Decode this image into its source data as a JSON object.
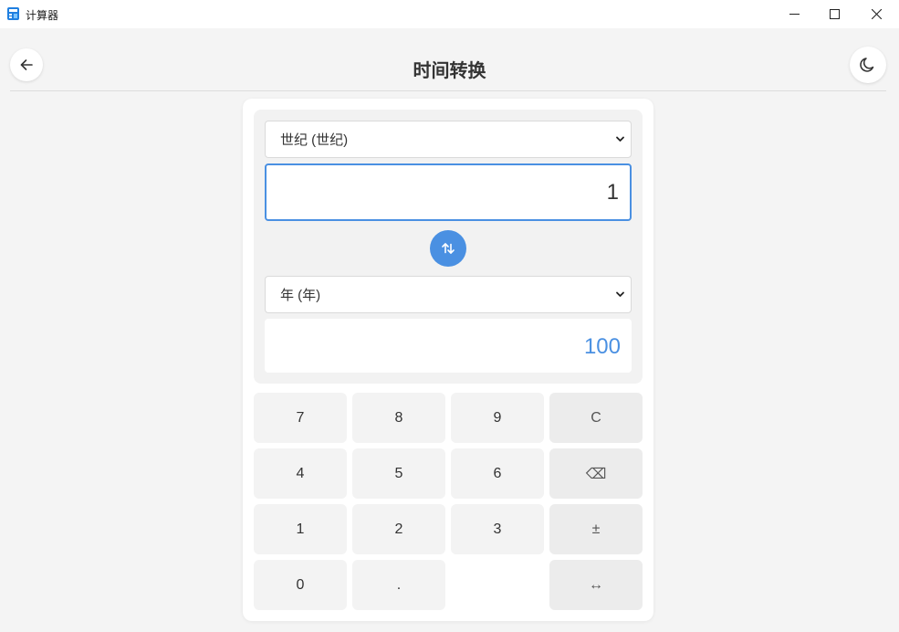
{
  "window": {
    "title": "计算器",
    "minimize_icon": "minimize-icon",
    "maximize_icon": "maximize-icon",
    "close_icon": "close-icon"
  },
  "header": {
    "title": "时间转换",
    "back_icon": "arrow-left-icon",
    "theme_icon": "moon-icon"
  },
  "converter": {
    "from_unit": "世纪 (世纪)",
    "from_value": "1",
    "to_unit": "年 (年)",
    "to_value": "100",
    "swap_icon": "swap-vertical-icon"
  },
  "keypad": {
    "keys": [
      "7",
      "8",
      "9",
      "C",
      "4",
      "5",
      "6",
      "⌫",
      "1",
      "2",
      "3",
      "±",
      "0",
      ".",
      "↔"
    ]
  },
  "colors": {
    "accent": "#4a90e2",
    "background": "#f4f4f4",
    "card": "#ffffff"
  }
}
